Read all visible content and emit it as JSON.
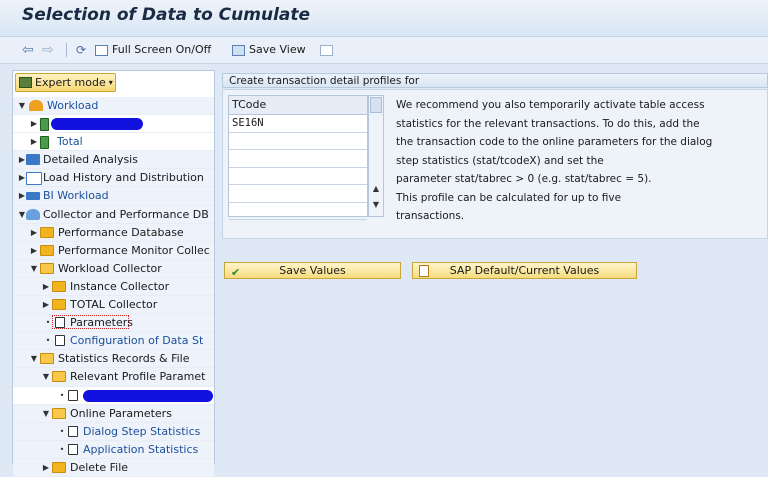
{
  "window": {
    "title": "Selection of Data to Cumulate"
  },
  "toolbar": {
    "back_icon": "back-arrow-icon",
    "forward_icon": "forward-arrow-icon",
    "fullscreen_label": "Full Screen On/Off",
    "save_view_label": "Save View"
  },
  "sidebar": {
    "expert_mode_label": "Expert mode",
    "tree": [
      {
        "label": "Workload"
      },
      {
        "label": ""
      },
      {
        "label": "Total"
      },
      {
        "label": "Detailed Analysis"
      },
      {
        "label": "Load History and Distribution"
      },
      {
        "label": "BI Workload"
      },
      {
        "label": "Collector and Performance DB"
      },
      {
        "label": "Performance Database"
      },
      {
        "label": "Performance Monitor Collec"
      },
      {
        "label": "Workload Collector"
      },
      {
        "label": "Instance Collector"
      },
      {
        "label": "TOTAL Collector"
      },
      {
        "label": "Parameters"
      },
      {
        "label": "Configuration of Data St"
      },
      {
        "label": "Statistics Records & File"
      },
      {
        "label": "Relevant Profile Paramet"
      },
      {
        "label": ""
      },
      {
        "label": "Online Parameters"
      },
      {
        "label": "Dialog Step Statistics"
      },
      {
        "label": "Application Statistics"
      },
      {
        "label": "Delete File"
      }
    ]
  },
  "main": {
    "section_title": "Create transaction detail profiles for",
    "table": {
      "header": "TCode",
      "rows": [
        "SE16N",
        "",
        "",
        "",
        "",
        ""
      ]
    },
    "recommendation": [
      "We recommend you also temporarily activate table access",
      "statistics for the relevant transactions. To do this, add the",
      "the transaction code to the online parameters for the dialog",
      "step statistics (stat/tcodeX) and set the",
      "parameter stat/tabrec > 0 (e.g. stat/tabrec = 5).",
      "This profile can be calculated for up to five",
      "transactions."
    ],
    "save_button": "Save Values",
    "default_button": "SAP Default/Current Values"
  }
}
